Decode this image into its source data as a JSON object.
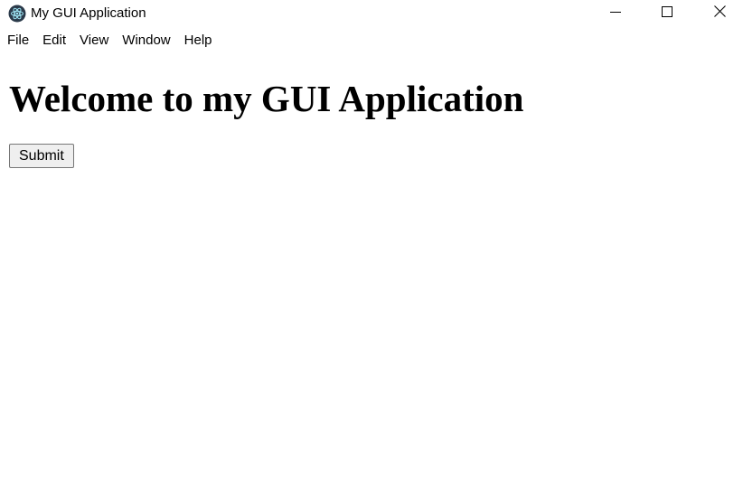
{
  "window": {
    "title": "My GUI Application",
    "app_icon": "electron-atom-icon",
    "controls": {
      "minimize_icon": "minimize-icon",
      "maximize_icon": "maximize-icon",
      "close_icon": "close-icon"
    }
  },
  "menubar": {
    "items": [
      {
        "label": "File"
      },
      {
        "label": "Edit"
      },
      {
        "label": "View"
      },
      {
        "label": "Window"
      },
      {
        "label": "Help"
      }
    ]
  },
  "content": {
    "heading": "Welcome to my GUI Application",
    "submit_label": "Submit"
  },
  "colors": {
    "background": "#ffffff",
    "text": "#000000",
    "button_bg": "#efefef",
    "button_border": "#767676",
    "icon_dark": "#2b3a4a"
  }
}
